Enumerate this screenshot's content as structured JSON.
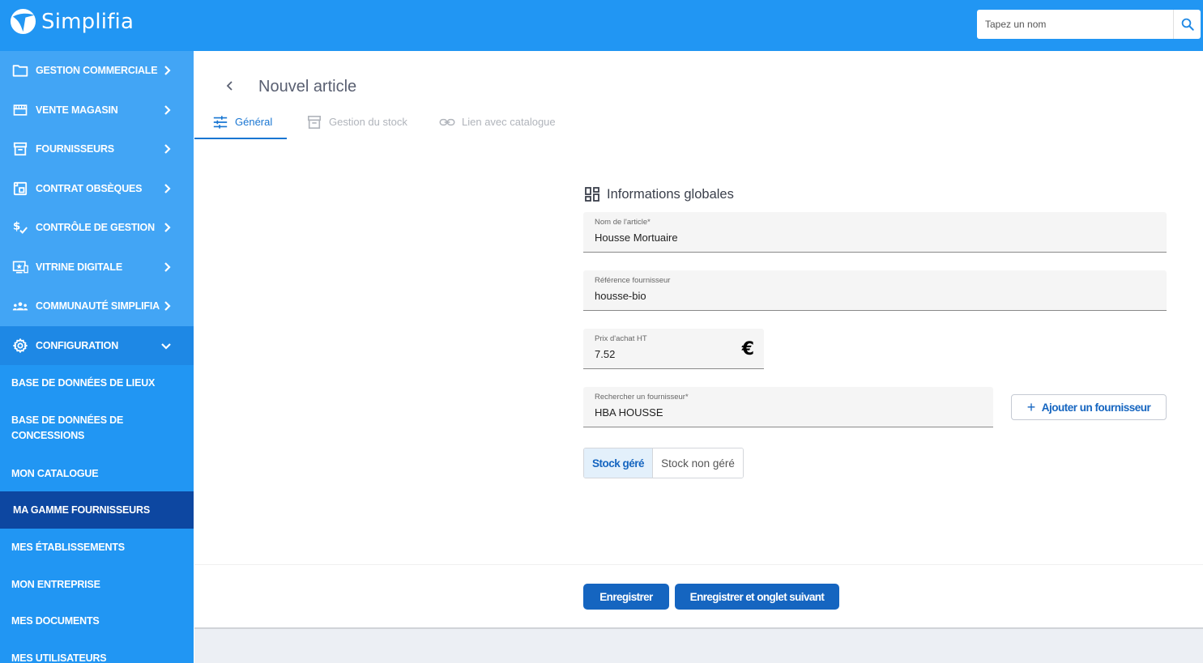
{
  "app": {
    "name": "Simplifia"
  },
  "header": {
    "search_placeholder": "Tapez un nom",
    "search_icon": "search-icon"
  },
  "sidebar": {
    "items": [
      {
        "label": "GESTION COMMERCIALE",
        "icon": "folder-icon"
      },
      {
        "label": "VENTE MAGASIN",
        "icon": "store-icon"
      },
      {
        "label": "FOURNISSEURS",
        "icon": "archive-icon"
      },
      {
        "label": "CONTRAT OBSÈQUES",
        "icon": "contract-icon"
      },
      {
        "label": "CONTRÔLE DE GESTION",
        "icon": "money-check-icon"
      },
      {
        "label": "VITRINE DIGITALE",
        "icon": "screen-star-icon"
      },
      {
        "label": "COMMUNAUTÉ SIMPLIFIA",
        "icon": "people-icon"
      },
      {
        "label": "CONFIGURATION",
        "icon": "gear-icon"
      }
    ],
    "sub_items": [
      {
        "label": "BASE DE DONNÉES DE LIEUX"
      },
      {
        "label": "BASE DE DONNÉES DE CONCESSIONS"
      },
      {
        "label": "MON CATALOGUE"
      },
      {
        "label": "MA GAMME FOURNISSEURS"
      },
      {
        "label": "MES ÉTABLISSEMENTS"
      },
      {
        "label": "MON ENTREPRISE"
      },
      {
        "label": "MES DOCUMENTS"
      },
      {
        "label": "MES UTILISATEURS"
      }
    ]
  },
  "page": {
    "title": "Nouvel article",
    "tabs": [
      {
        "label": "Général"
      },
      {
        "label": "Gestion du stock"
      },
      {
        "label": "Lien avec catalogue"
      }
    ],
    "section_title": "Informations globales",
    "fields": {
      "name": {
        "label": "Nom de l'article",
        "required_mark": "*",
        "value": "Housse Mortuaire"
      },
      "supplier_ref": {
        "label": "Référence fournisseur",
        "value": "housse-bio"
      },
      "price": {
        "label": "Prix d'achat HT",
        "value": "7.52",
        "suffix": "€"
      },
      "supplier": {
        "label": "Rechercher un fournisseur",
        "required_mark": "*",
        "value": "HBA HOUSSE"
      }
    },
    "add_supplier_label": "Ajouter un fournisseur",
    "add_supplier_plus": "+",
    "stock_toggle": {
      "on_label": "Stock géré",
      "off_label": "Stock non géré"
    },
    "actions": {
      "save_label": "Enregistrer",
      "save_next_label": "Enregistrer et onglet suivant"
    }
  },
  "colors": {
    "header": "#2196f3",
    "sidebar": "#42a5f5",
    "sidebar_selected": "#0d47a1",
    "primary_button": "#1565c0"
  }
}
